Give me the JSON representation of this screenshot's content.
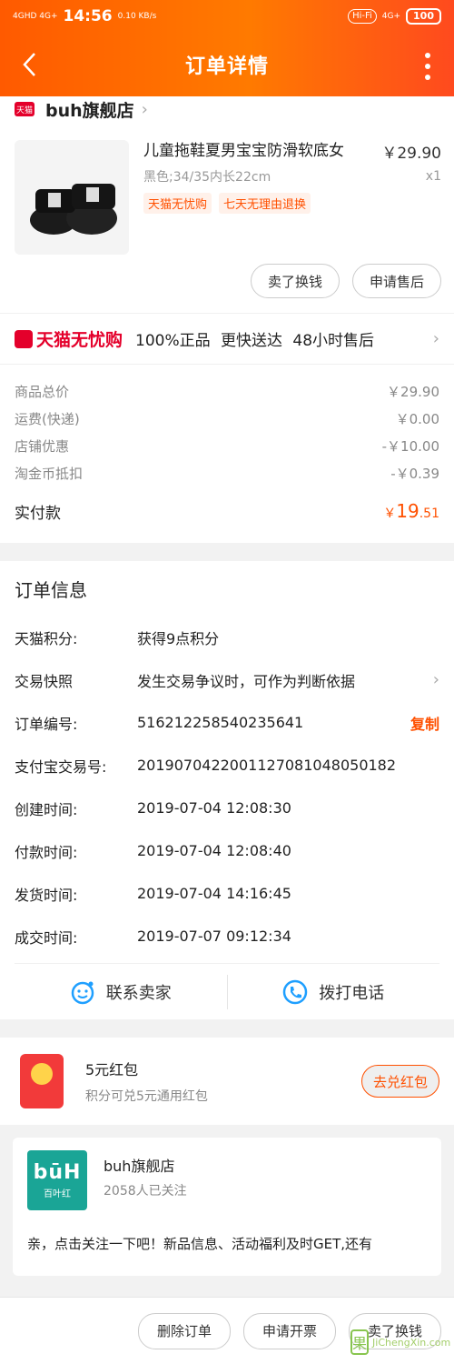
{
  "status_bar": {
    "network_left": "4GHD 4G+",
    "time": "14:56",
    "speed": "0.10 KB/s",
    "hifi": "Hi-Fi",
    "network_right": "4G+",
    "battery": "100"
  },
  "header": {
    "title": "订单详情"
  },
  "shop": {
    "badge": "天猫",
    "name": "buh旗舰店"
  },
  "item": {
    "title": "儿童拖鞋夏男宝宝防滑软底女",
    "spec": "黑色;34/35内长22cm",
    "price": "￥29.90",
    "qty": "x1",
    "tags": [
      "天猫无忧购",
      "七天无理由退换"
    ]
  },
  "item_actions": {
    "sell": "卖了换钱",
    "after_sale": "申请售后"
  },
  "guarantee": {
    "brand": "天猫无忧购",
    "text": "100%正品 更快送达 48小时售后"
  },
  "fees": [
    {
      "label": "商品总价",
      "value": "￥29.90"
    },
    {
      "label": "运费(快递)",
      "value": "￥0.00"
    },
    {
      "label": "店铺优惠",
      "value": "-￥10.00"
    },
    {
      "label": "淘金币抵扣",
      "value": "-￥0.39"
    }
  ],
  "total": {
    "label": "实付款",
    "currency": "￥",
    "integer": "19",
    "decimal": ".51"
  },
  "order_info": {
    "title": "订单信息",
    "rows": [
      {
        "label": "天猫积分:",
        "value": "获得9点积分"
      },
      {
        "label": "交易快照",
        "value": "发生交易争议时，可作为判断依据"
      },
      {
        "label": "订单编号:",
        "value": "516212258540235641",
        "action": "复制"
      },
      {
        "label": "支付宝交易号:",
        "value": "2019070422001127081048050182"
      },
      {
        "label": "创建时间:",
        "value": "2019-07-04 12:08:30"
      },
      {
        "label": "付款时间:",
        "value": "2019-07-04 12:08:40"
      },
      {
        "label": "发货时间:",
        "value": "2019-07-04 14:16:45"
      },
      {
        "label": "成交时间:",
        "value": "2019-07-07 09:12:34"
      }
    ]
  },
  "contact": {
    "seller": "联系卖家",
    "call": "拨打电话"
  },
  "red_packet": {
    "title": "5元红包",
    "subtitle": "积分可兑5元通用红包",
    "button": "去兑红包"
  },
  "shop_card": {
    "logo_main": "būH",
    "logo_sub": "百叶红",
    "name": "buh旗舰店",
    "followers": "2058人已关注",
    "message": "亲，点击关注一下吧！新品信息、活动福利及时GET,还有"
  },
  "bottom_bar": {
    "delete": "删除订单",
    "invoice": "申请开票",
    "sell": "卖了换钱"
  },
  "watermark": {
    "text": "JiChengXin.com"
  },
  "colors": {
    "accent": "#ff5000",
    "tmall_red": "#e4002b",
    "header_start": "#ff5a00",
    "header_end": "#ff4a1e"
  }
}
